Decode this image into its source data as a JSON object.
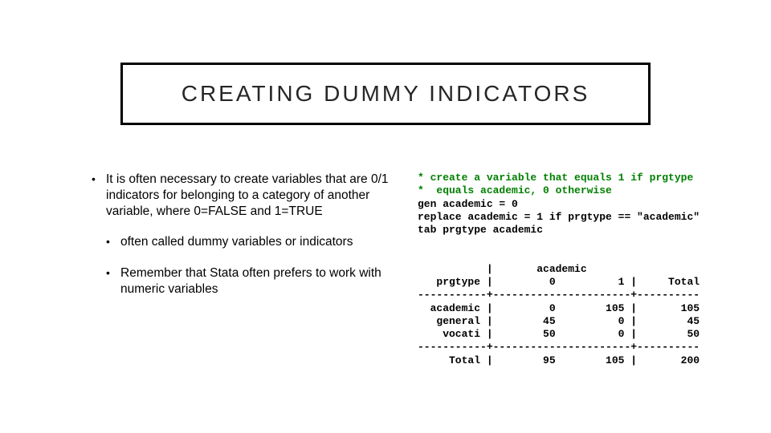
{
  "title": "CREATING DUMMY INDICATORS",
  "bullets": {
    "main": "It is often necessary to create variables that are 0/1 indicators for belonging to a category of another variable, where 0=FALSE and 1=TRUE",
    "sub1": "often called dummy variables or indicators",
    "sub2": "Remember that Stata often prefers to work with numeric variables"
  },
  "code": {
    "c1": "* create a variable that equals 1 if prgtype",
    "c2": "*  equals academic, 0 otherwise",
    "l1": "gen academic = 0",
    "l2": "replace academic = 1 if prgtype == \"academic\"",
    "l3": "tab prgtype academic"
  },
  "table": {
    "h1": "           |       academic",
    "h2": "   prgtype |         0          1 |     Total",
    "sep": "-----------+----------------------+----------",
    "r1": "  academic |         0        105 |       105",
    "r2": "   general |        45          0 |        45",
    "r3": "    vocati |        50          0 |        50",
    "tot": "     Total |        95        105 |       200"
  },
  "chart_data": {
    "type": "table",
    "title": "tab prgtype academic",
    "row_var": "prgtype",
    "col_var": "academic",
    "col_labels": [
      "0",
      "1"
    ],
    "rows": [
      {
        "label": "academic",
        "values": [
          0,
          105
        ],
        "total": 105
      },
      {
        "label": "general",
        "values": [
          45,
          0
        ],
        "total": 45
      },
      {
        "label": "vocati",
        "values": [
          50,
          0
        ],
        "total": 50
      }
    ],
    "col_totals": [
      95,
      105
    ],
    "grand_total": 200
  }
}
